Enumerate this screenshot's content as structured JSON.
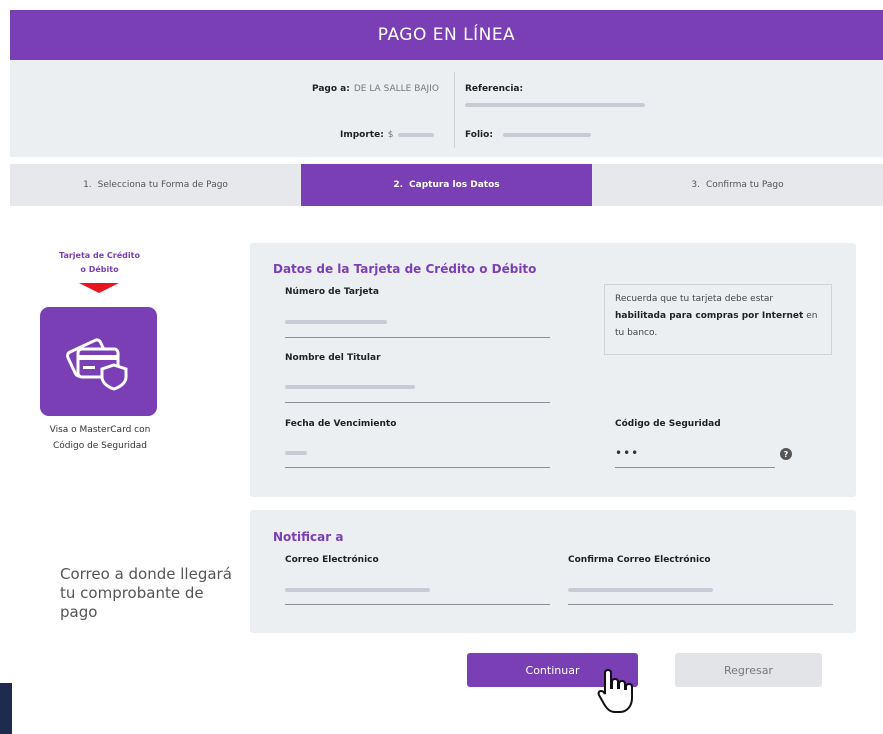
{
  "header": {
    "title": "PAGO EN LÍNEA"
  },
  "summary": {
    "pago_a_label": "Pago a:",
    "pago_a_value": "DE LA SALLE BAJIO",
    "importe_label": "Importe:",
    "importe_value": "$",
    "referencia_label": "Referencia:",
    "folio_label": "Folio:"
  },
  "steps": [
    {
      "num": "1.",
      "label": "Selecciona tu Forma de Pago",
      "active": false
    },
    {
      "num": "2.",
      "label": "Captura los Datos",
      "active": true
    },
    {
      "num": "3.",
      "label": "Confirma tu Pago",
      "active": false
    }
  ],
  "payment_method": {
    "title_line1": "Tarjeta de Crédito",
    "title_line2": "o Débito",
    "caption_line1": "Visa o MasterCard con",
    "caption_line2": "Código de Seguridad",
    "icon": "credit-card-shield-icon"
  },
  "card_form": {
    "title": "Datos de la Tarjeta de Crédito o Débito",
    "card_number_label": "Número de Tarjeta",
    "holder_label": "Nombre del Titular",
    "expiry_label": "Fecha de Vencimiento",
    "cvv_label": "Código de Seguridad",
    "cvv_value": "•••",
    "help_icon_glyph": "?",
    "notice_line1": "Recuerda que tu tarjeta debe estar",
    "notice_bold": "habilitada para compras por Internet",
    "notice_mid": " en",
    "notice_line3": "tu banco."
  },
  "notify": {
    "title": "Notificar a",
    "email_label": "Correo Electrónico",
    "confirm_email_label": "Confirma Correo Electrónico",
    "note_line1": "Correo a donde llegará",
    "note_line2": "tu comprobante de pago"
  },
  "buttons": {
    "continue_label": "Continuar",
    "back_label": "Regresar"
  },
  "colors": {
    "brand_purple": "#7b3fb5",
    "panel_gray": "#eceff2",
    "arrow_red": "#e8141e"
  }
}
